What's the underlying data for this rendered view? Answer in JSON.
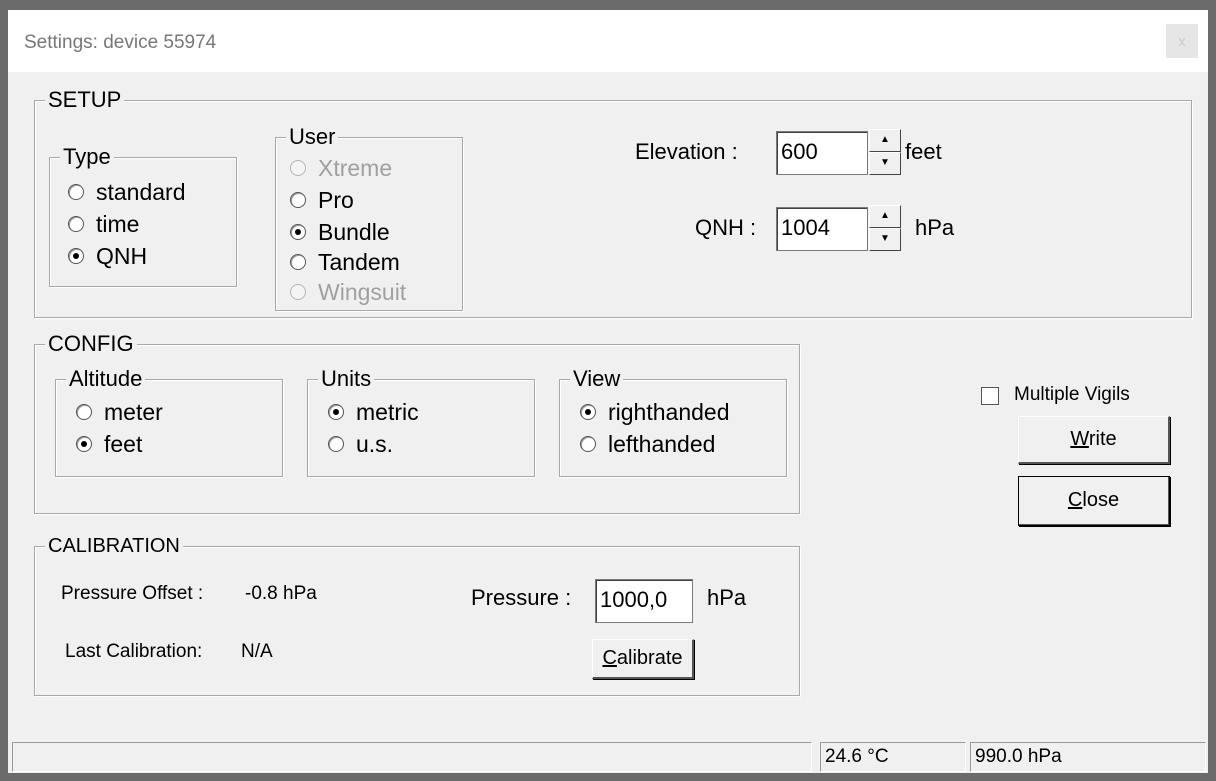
{
  "window": {
    "title": "Settings: device 55974",
    "close_icon": "x"
  },
  "setup": {
    "legend": "SETUP",
    "type": {
      "legend": "Type",
      "options": [
        "standard",
        "time",
        "QNH"
      ],
      "selected": "QNH"
    },
    "user": {
      "legend": "User",
      "options": [
        "Xtreme",
        "Pro",
        "Bundle",
        "Tandem",
        "Wingsuit"
      ],
      "disabled": [
        "Xtreme",
        "Wingsuit"
      ],
      "selected": "Bundle"
    },
    "elevation": {
      "label": "Elevation :",
      "value": "600",
      "unit": "feet"
    },
    "qnh": {
      "label": "QNH :",
      "value": "1004",
      "unit": "hPa"
    }
  },
  "config": {
    "legend": "CONFIG",
    "altitude": {
      "legend": "Altitude",
      "options": [
        "meter",
        "feet"
      ],
      "selected": "feet"
    },
    "units": {
      "legend": "Units",
      "options": [
        "metric",
        "u.s."
      ],
      "selected": "metric"
    },
    "view": {
      "legend": "View",
      "options": [
        "righthanded",
        "lefthanded"
      ],
      "selected": "righthanded"
    }
  },
  "calibration": {
    "legend": "CALIBRATION",
    "pressure_offset_label": "Pressure Offset :",
    "pressure_offset_value": "-0.8  hPa",
    "last_calibration_label": "Last Calibration:",
    "last_calibration_value": "N/A",
    "pressure_label": "Pressure :",
    "pressure_value": "1000,0",
    "pressure_unit": "hPa",
    "calibrate_button": {
      "accel": "C",
      "rest": "alibrate"
    }
  },
  "side": {
    "multiple_vigils_label": "Multiple Vigils",
    "multiple_vigils_checked": false,
    "write_button": {
      "accel": "W",
      "rest": "rite"
    },
    "close_button": {
      "accel": "C",
      "rest": "lose"
    }
  },
  "statusbar": {
    "message": "",
    "temperature": "24.6 °C",
    "pressure": "990.0 hPa"
  }
}
